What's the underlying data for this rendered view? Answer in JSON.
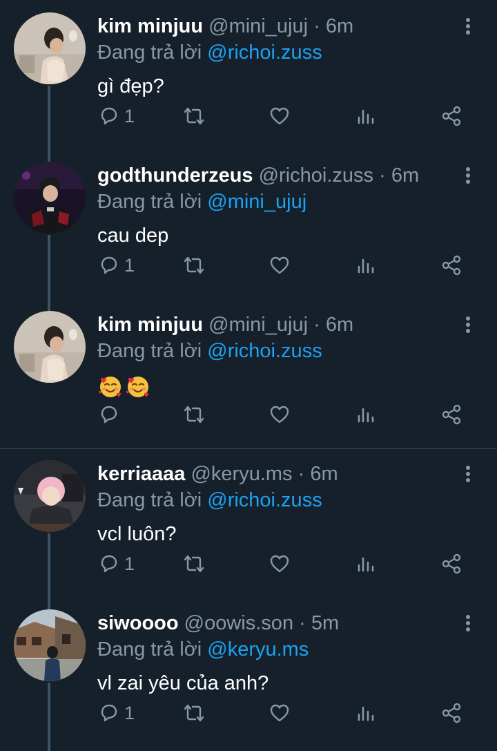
{
  "colors": {
    "background": "#15202b",
    "secondary_text": "#8899a6",
    "mention": "#1da1f2",
    "thread_line": "#3d5466"
  },
  "tweets": [
    {
      "name": "kim minjuu",
      "handle": "@mini_ujuj",
      "sep": "·",
      "time": "6m",
      "reply_prefix": "Đang trả lời",
      "reply_to": "@richoi.zuss",
      "text": "gì đẹp?",
      "reply_count": "1",
      "avatar": "avatar-photo"
    },
    {
      "name": "godthunderzeus",
      "handle": "@richoi.zuss",
      "sep": "·",
      "time": "6m",
      "reply_prefix": "Đang trả lời",
      "reply_to": "@mini_ujuj",
      "text": "cau dep",
      "reply_count": "1",
      "avatar": "avatar-photo"
    },
    {
      "name": "kim minjuu",
      "handle": "@mini_ujuj",
      "sep": "·",
      "time": "6m",
      "reply_prefix": "Đang trả lời",
      "reply_to": "@richoi.zuss",
      "text": "",
      "emojis": [
        "smiling-face-with-hearts",
        "smiling-face-with-hearts"
      ],
      "reply_count": "",
      "avatar": "avatar-photo"
    },
    {
      "name": "kerriaaaa",
      "handle": "@keryu.ms",
      "sep": "·",
      "time": "6m",
      "reply_prefix": "Đang trả lời",
      "reply_to": "@richoi.zuss",
      "text": "vcl luôn?",
      "reply_count": "1",
      "avatar": "avatar-photo"
    },
    {
      "name": "siwoooo",
      "handle": "@oowis.son",
      "sep": "·",
      "time": "5m",
      "reply_prefix": "Đang trả lời",
      "reply_to": "@keryu.ms",
      "text": "vl zai yêu của anh?",
      "reply_count": "1",
      "avatar": "avatar-photo"
    }
  ],
  "icons": {
    "reply": "reply-icon",
    "retweet": "retweet-icon",
    "like": "heart-icon",
    "analytics": "analytics-icon",
    "share": "share-icon",
    "more": "more-vertical-icon"
  }
}
